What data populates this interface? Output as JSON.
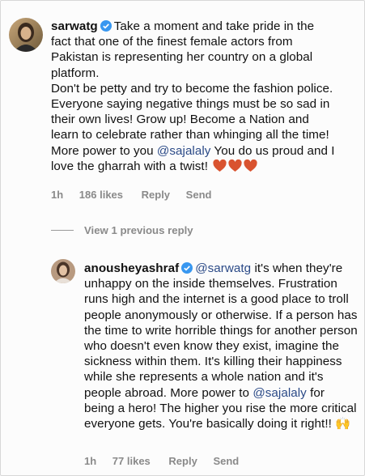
{
  "comment1": {
    "username": "sarwatg",
    "paragraphs": [
      "Take a moment and take pride in the fact that one of the finest female actors from Pakistan is representing her country on a global platform.",
      "Don't be petty and try to become the fashion police. Everyone saying negative things must be so sad in their own lives! Grow up! Become a Nation and learn to celebrate rather than whinging all the time!"
    ],
    "last_pre": "More power to you ",
    "last_mention": "@sajalaly",
    "last_post": " You do us proud and I love the gharrah with a twist!",
    "emoji": "❤️❤️❤️",
    "time": "1h",
    "likes": "186 likes",
    "reply_label": "Reply",
    "send_label": "Send"
  },
  "view_replies": "View 1 previous reply",
  "comment2": {
    "username": "anousheyashraf",
    "mention1": "@sarwatg",
    "text1": " it's when they're unhappy on the inside themselves. Frustration runs high and the internet is a good place to troll people anonymously or otherwise. If a person has the time to write horrible things for another person who doesn't even know they exist, imagine the sickness within them. It's killing their happiness while she represents a whole nation and it's people abroad. More power to ",
    "mention2": "@sajalaly",
    "text2": " for being a hero! The higher you rise the more critical everyone gets. You're basically doing it right!! 🙌",
    "time": "1h",
    "likes": "77 likes",
    "reply_label": "Reply",
    "send_label": "Send"
  },
  "colors": {
    "mention": "#2b4a87",
    "verified": "#3897f0",
    "meta": "#8a8a8a"
  }
}
